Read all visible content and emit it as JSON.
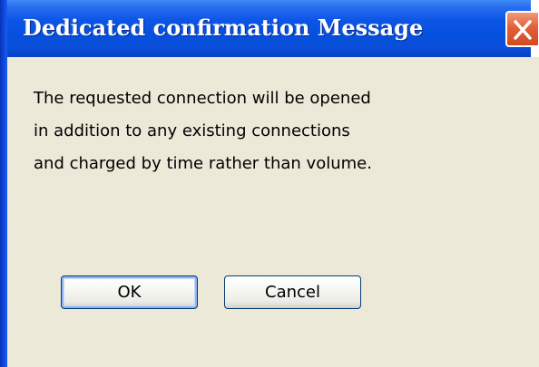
{
  "window": {
    "title": "Dedicated confirmation Message",
    "close_icon": "close-icon"
  },
  "message": {
    "lines": [
      "The requested connection will be opened",
      "in addition to any existing connections",
      "and charged by time rather than volume."
    ]
  },
  "buttons": {
    "ok_label": "OK",
    "cancel_label": "Cancel"
  },
  "colors": {
    "titlebar": "#0a4fd9",
    "close_button": "#e2603a",
    "dialog_background": "#ece9d8",
    "button_border": "#003c74"
  }
}
